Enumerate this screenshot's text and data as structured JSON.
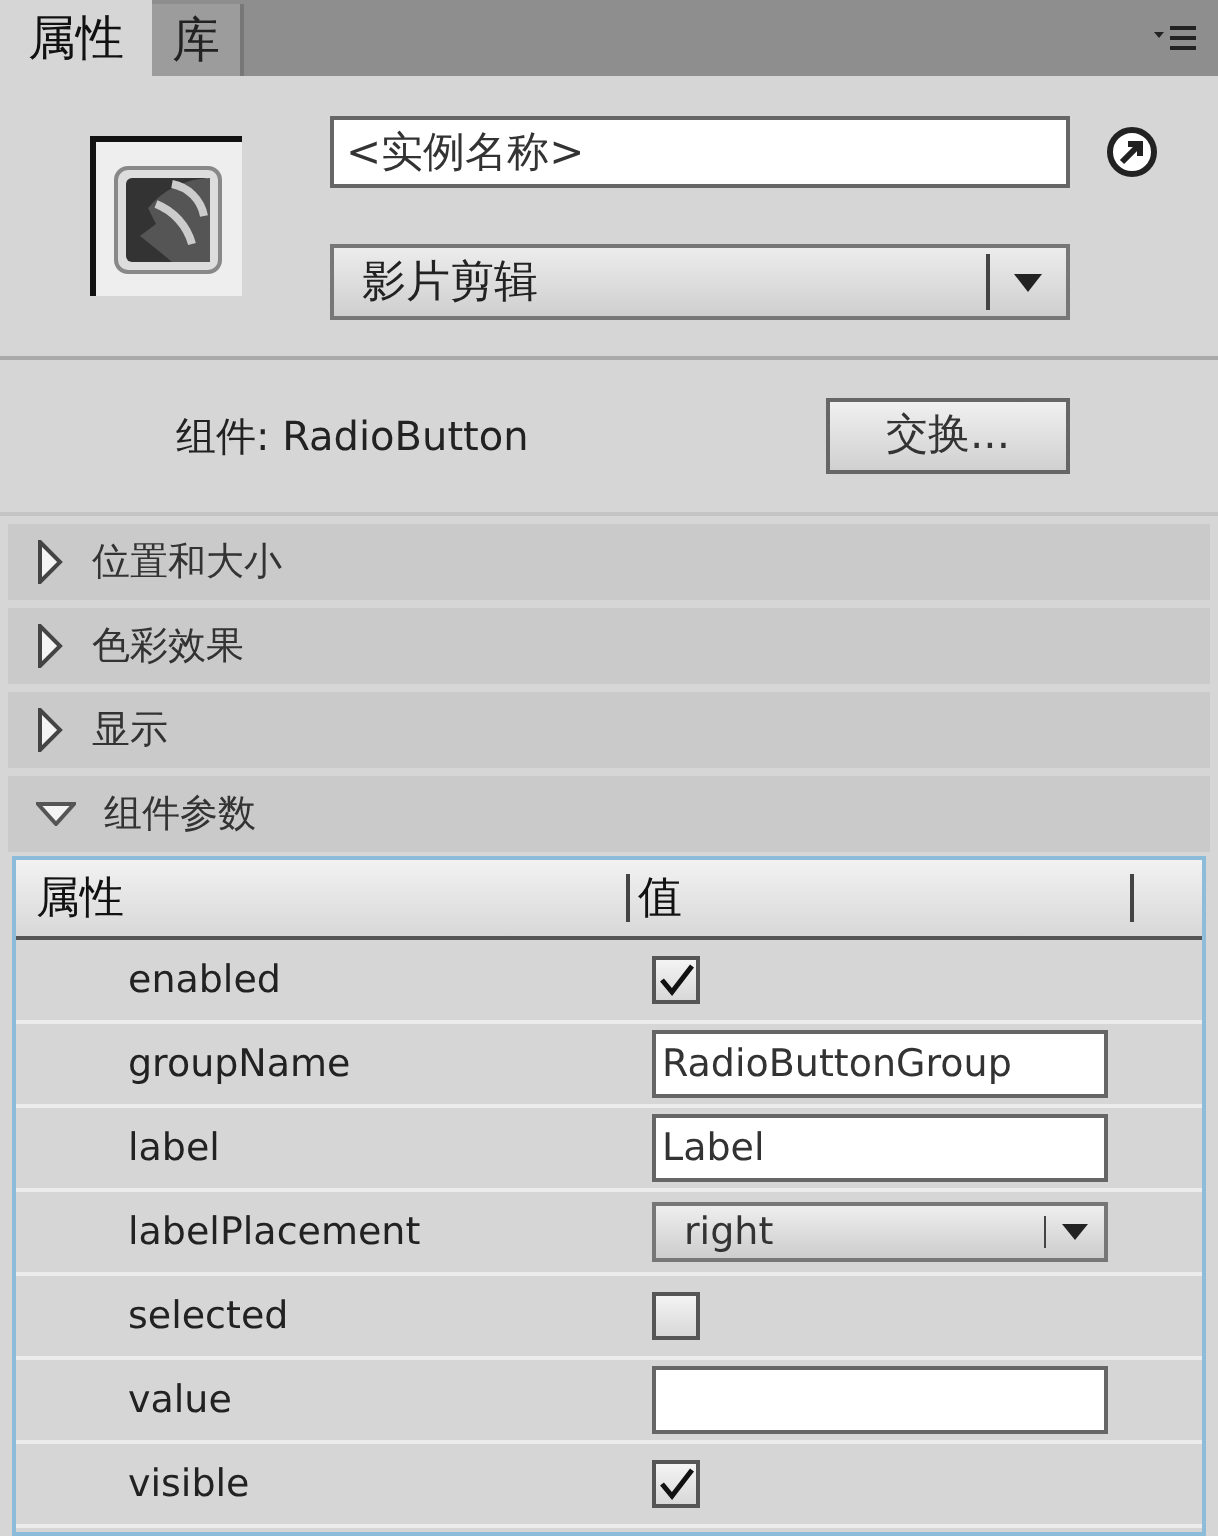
{
  "tabs": [
    {
      "label": "属性",
      "selected": true
    },
    {
      "label": "库",
      "selected": false
    }
  ],
  "instance": {
    "placeholder": "<实例名称>",
    "type": "影片剪辑"
  },
  "component": {
    "label": "组件: RadioButton",
    "swap_button": "交换..."
  },
  "sections": [
    {
      "label": "位置和大小",
      "expanded": false
    },
    {
      "label": "色彩效果",
      "expanded": false
    },
    {
      "label": "显示",
      "expanded": false
    },
    {
      "label": "组件参数",
      "expanded": true
    }
  ],
  "table": {
    "columns": [
      "属性",
      "值"
    ],
    "rows": [
      {
        "name": "enabled",
        "kind": "checkbox",
        "checked": true
      },
      {
        "name": "groupName",
        "kind": "text",
        "value": "RadioButtonGroup"
      },
      {
        "name": "label",
        "kind": "text",
        "value": "Label"
      },
      {
        "name": "labelPlacement",
        "kind": "dropdown",
        "value": "right"
      },
      {
        "name": "selected",
        "kind": "checkbox",
        "checked": false
      },
      {
        "name": "value",
        "kind": "text",
        "value": ""
      },
      {
        "name": "visible",
        "kind": "checkbox",
        "checked": true
      }
    ]
  }
}
